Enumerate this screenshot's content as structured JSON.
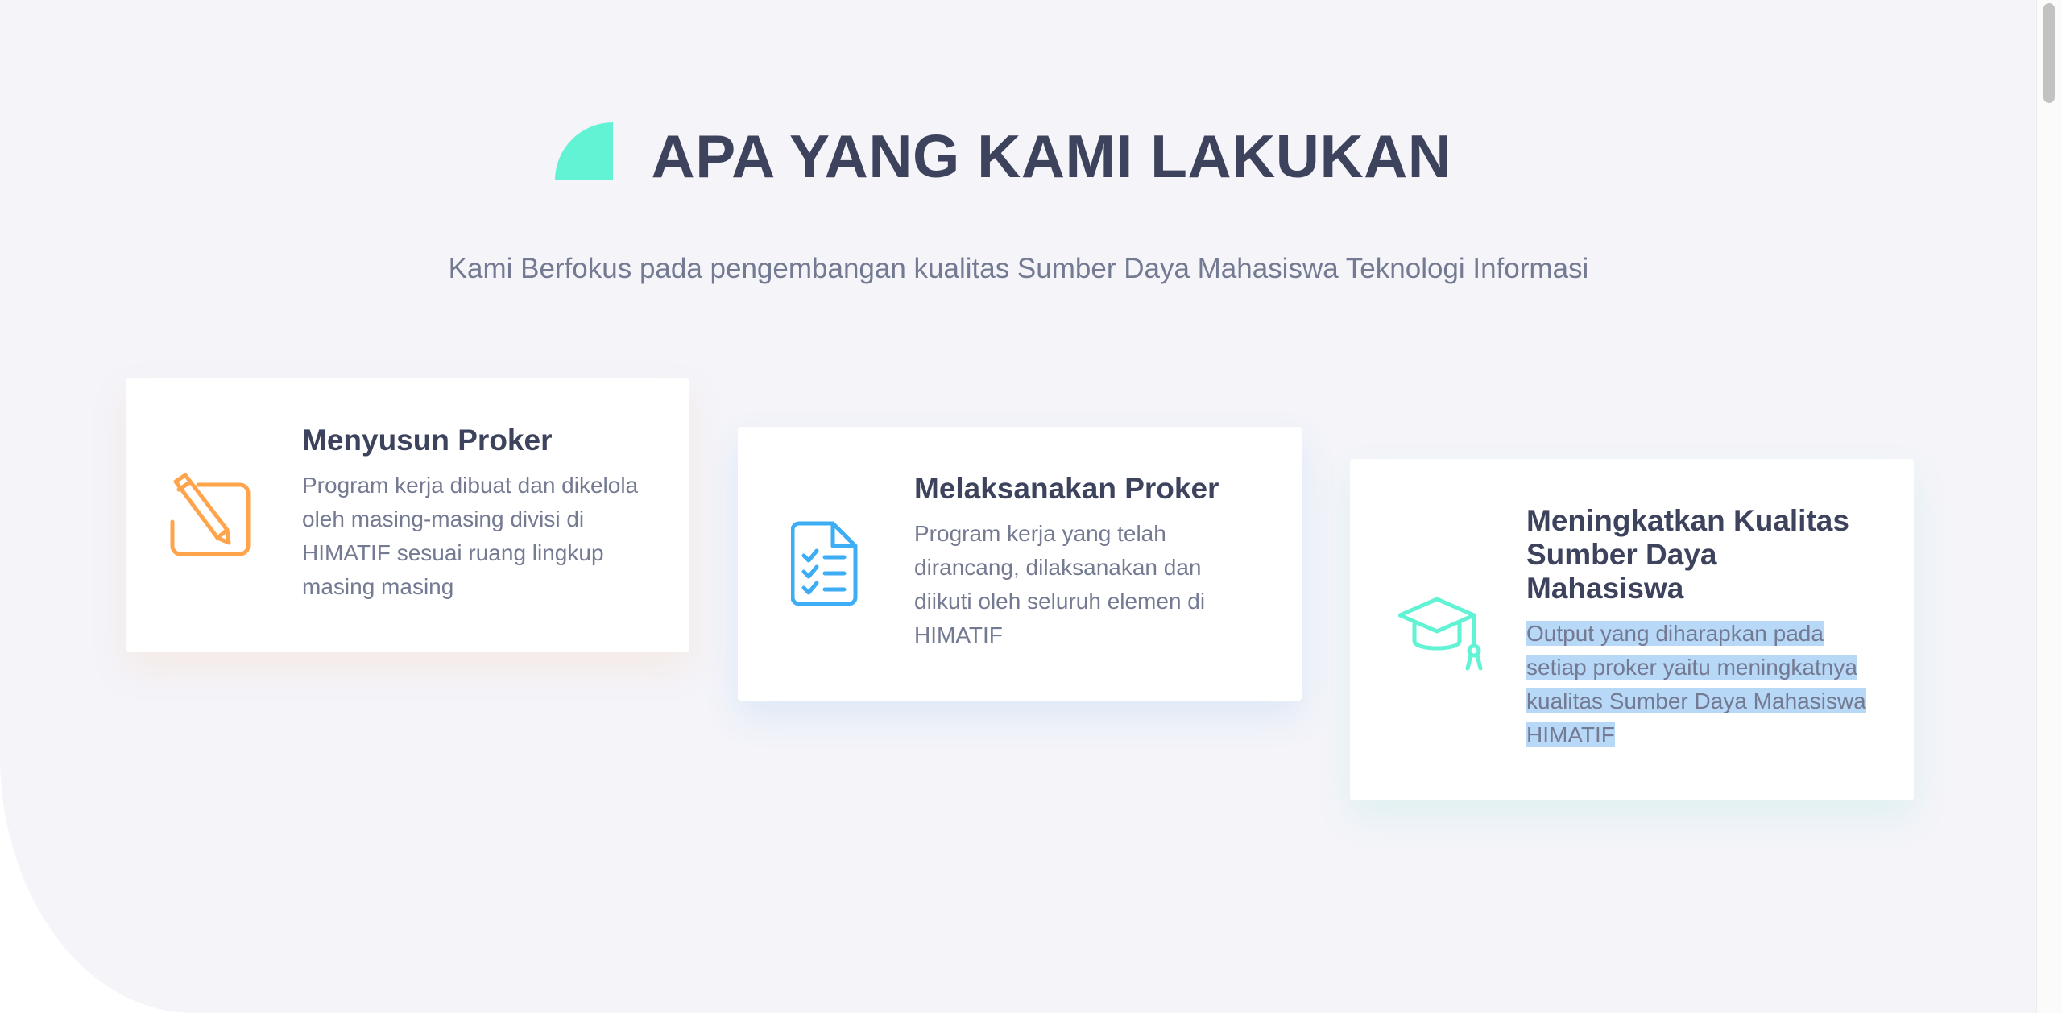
{
  "section": {
    "title": "APA YANG KAMI LAKUKAN",
    "subtitle": "Kami Berfokus pada pengembangan kualitas Sumber Daya Mahasiswa Teknologi Informasi"
  },
  "cards": [
    {
      "icon": "pencil-square-icon",
      "title": "Menyusun Proker",
      "text": "Program kerja dibuat dan dikelola oleh masing-masing divisi di HIMATIF sesuai ruang lingkup masing masing"
    },
    {
      "icon": "checklist-icon",
      "title": "Melaksanakan Proker",
      "text": "Program kerja yang telah dirancang, dilaksanakan dan diikuti oleh seluruh elemen di HIMATIF"
    },
    {
      "icon": "graduation-cap-icon",
      "title": "Meningkatkan Kualitas Sumber Daya Mahasiswa",
      "text": "Output yang diharapkan pada setiap proker yaitu meningkatnya kualitas Sumber Daya Mahasiswa HIMATIF"
    }
  ],
  "colors": {
    "accent_teal": "#62f2d4",
    "orange": "#ffa44b",
    "blue": "#3daef6",
    "heading": "#3d435d",
    "body_text": "#737a91",
    "background": "#f4f4f9",
    "selection": "#b8d8f8"
  }
}
